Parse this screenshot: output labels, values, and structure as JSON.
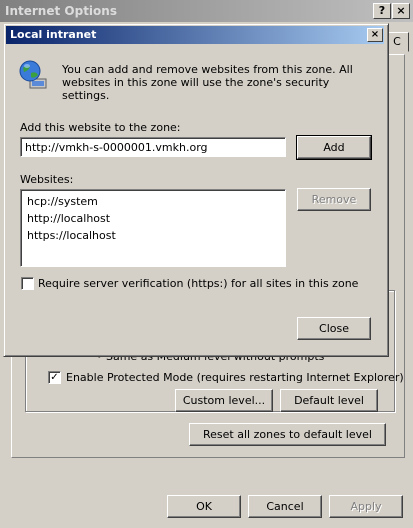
{
  "background_window": {
    "title": "Internet Options",
    "help_glyph": "?",
    "close_glyph": "×",
    "tab_stub_glyph": "C",
    "partial_text": "• Same as Medium level without prompts",
    "protected_mode_label": "Enable Protected Mode (requires restarting Internet Explorer)",
    "protected_mode_checked": true,
    "check_glyph": "✓",
    "custom_level_label": "Custom level...",
    "default_level_label": "Default level",
    "reset_all_label": "Reset all zones to default level",
    "ok_label": "OK",
    "cancel_label": "Cancel",
    "apply_label": "Apply"
  },
  "dialog": {
    "title": "Local intranet",
    "close_glyph": "×",
    "icon": "globe-network-icon",
    "info_text": "You can add and remove websites from this zone. All websites in this zone will use the zone's security settings.",
    "add_label": "Add this website to the zone:",
    "add_value": "http://vmkh-s-0000001.vmkh.org",
    "add_button": "Add",
    "websites_label": "Websites:",
    "websites": [
      "hcp://system",
      "http://localhost",
      "https://localhost"
    ],
    "remove_button": "Remove",
    "require_https_label": "Require server verification (https:) for all sites in this zone",
    "require_https_checked": false,
    "close_button": "Close"
  }
}
